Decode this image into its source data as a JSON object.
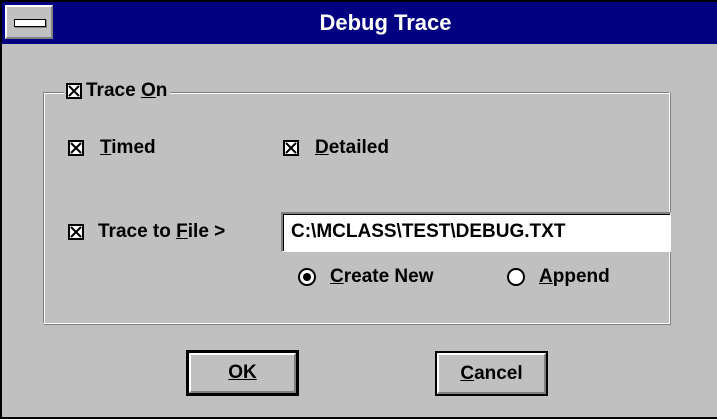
{
  "window": {
    "title": "Debug Trace"
  },
  "group": {
    "trace_on": {
      "label": "Trace On",
      "mnemonic": "O",
      "checked": true
    }
  },
  "options": {
    "timed": {
      "label": "Timed",
      "mnemonic": "T",
      "checked": true
    },
    "detailed": {
      "label": "Detailed",
      "mnemonic": "D",
      "checked": true
    },
    "trace_to_file": {
      "label": "Trace to File >",
      "mnemonic": "F",
      "checked": true
    }
  },
  "file": {
    "path": "C:\\MCLASS\\TEST\\DEBUG.TXT"
  },
  "mode": {
    "create_new": {
      "label": "Create New",
      "mnemonic": "C",
      "selected": true
    },
    "append": {
      "label": "Append",
      "mnemonic": "A",
      "selected": false
    }
  },
  "buttons": {
    "ok": "OK",
    "cancel": "Cancel"
  },
  "colors": {
    "title_bar": "#000080",
    "face": "#c0c0c0"
  },
  "icons": {
    "system_menu": "system-menu-icon",
    "check": "checkbox-x-icon",
    "radio": "radio-dot-icon"
  }
}
